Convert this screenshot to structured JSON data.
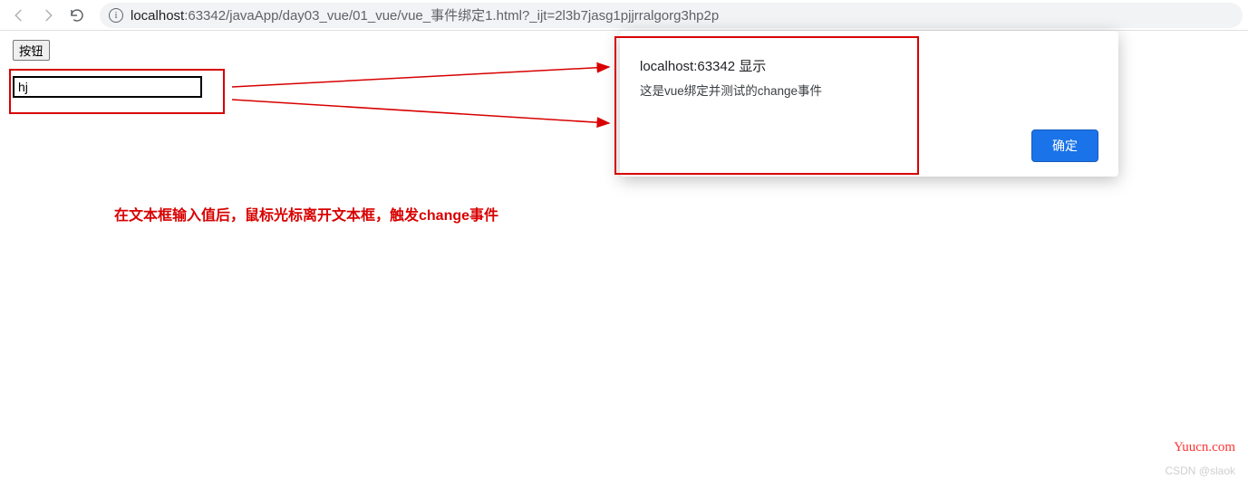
{
  "browser": {
    "url_host": "localhost",
    "url_port_path": ":63342/javaApp/day03_vue/01_vue/vue_事件绑定1.html?_ijt=2l3b7jasg1pjjrralgorg3hp2p"
  },
  "page": {
    "button_label": "按钮",
    "input_value": "hj",
    "caption": "在文本框输入值后，鼠标光标离开文本框，触发change事件"
  },
  "dialog": {
    "title": "localhost:63342 显示",
    "message": "这是vue绑定并测试的change事件",
    "ok_label": "确定"
  },
  "watermarks": {
    "site": "Yuucn.com",
    "credit": "CSDN @slaok"
  },
  "colors": {
    "annotation": "#d80000",
    "primary": "#1a73e8"
  }
}
